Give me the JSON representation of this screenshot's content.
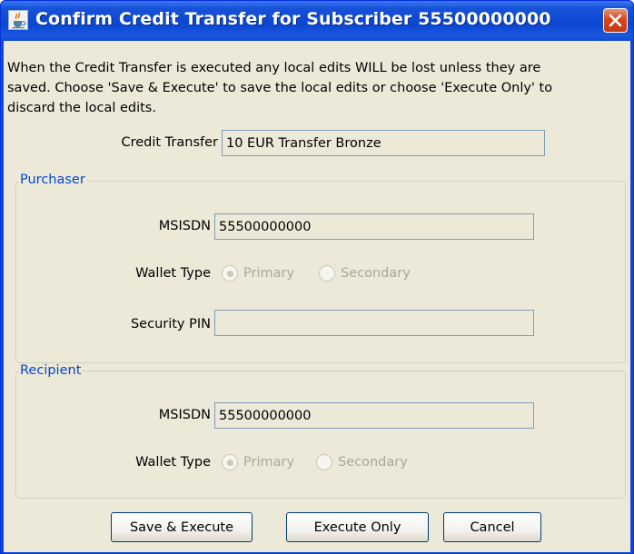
{
  "window": {
    "title": "Confirm Credit Transfer for Subscriber 55500000000"
  },
  "intro": {
    "line1": "When the Credit Transfer is executed any local edits WILL be lost unless they are",
    "line2": "saved. Choose 'Save & Execute' to save the local edits or choose 'Execute Only' to",
    "line3": "discard the local edits."
  },
  "credit_transfer": {
    "label": "Credit Transfer",
    "value": "10 EUR Transfer Bronze"
  },
  "purchaser": {
    "title": "Purchaser",
    "msisdn_label": "MSISDN",
    "msisdn_value": "55500000000",
    "wallet_type_label": "Wallet Type",
    "wallet_primary": "Primary",
    "wallet_secondary": "Secondary",
    "security_pin_label": "Security PIN",
    "security_pin_value": ""
  },
  "recipient": {
    "title": "Recipient",
    "msisdn_label": "MSISDN",
    "msisdn_value": "55500000000",
    "wallet_type_label": "Wallet Type",
    "wallet_primary": "Primary",
    "wallet_secondary": "Secondary"
  },
  "buttons": {
    "save_execute": "Save & Execute",
    "execute_only": "Execute Only",
    "cancel": "Cancel"
  },
  "colors": {
    "titlebar": "#0b47d2",
    "dialog_bg": "#ece9d8",
    "group_title": "#0046d5",
    "disabled_text": "#aca899",
    "close_button": "#d5471d"
  },
  "icons": {
    "app": "java-coffee-cup-icon",
    "close": "close-icon"
  }
}
